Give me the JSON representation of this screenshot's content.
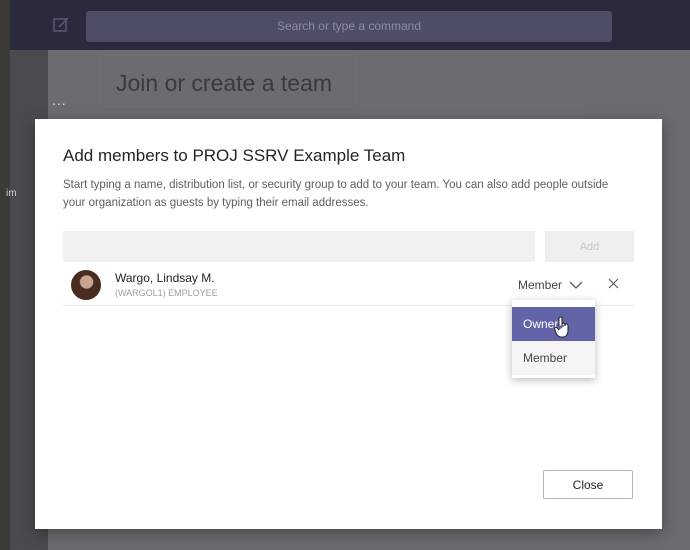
{
  "app": {
    "search_placeholder": "Search or type a command",
    "more_label": "...",
    "side_edge_text": "im",
    "background_title": "Join or create a team"
  },
  "dialog": {
    "title": "Add members to PROJ SSRV Example Team",
    "description": "Start typing a name, distribution list, or security group to add to your team. You can also add people outside your organization as guests by typing their email addresses.",
    "input_value": "",
    "add_label": "Add",
    "close_label": "Close"
  },
  "member": {
    "name": "Wargo, Lindsay M.",
    "subtitle": "(WARGOL1) EMPLOYEE",
    "role": "Member",
    "avatar_icon": "avatar",
    "remove_icon": "close-icon"
  },
  "role_menu": {
    "options": [
      "Owner",
      "Member"
    ],
    "highlighted": "Owner"
  },
  "colors": {
    "accent": "#6264a7",
    "topbar": "#2b2a3d"
  }
}
